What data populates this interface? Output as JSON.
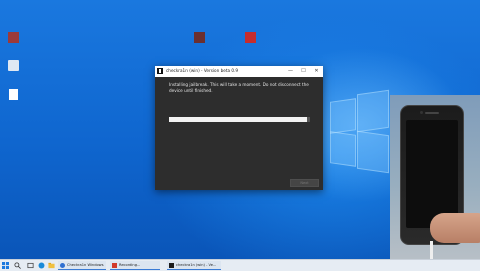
{
  "desktop": {
    "icons": [
      {
        "label": "",
        "glyph": "checkra1n-icon",
        "color": "#9b3a3a"
      },
      {
        "label": "",
        "glyph": "shortcut-icon",
        "color": "#6b2f2f"
      },
      {
        "label": "",
        "glyph": "recycle-bin-icon",
        "color": "#dfe8f3"
      },
      {
        "label": "",
        "glyph": "app-shortcut-icon",
        "color": "#c62d2d"
      },
      {
        "label": "",
        "glyph": "document-icon",
        "color": "#ffffff"
      }
    ]
  },
  "window": {
    "title": "checkra1n (win) - Version beta 0.9",
    "min_glyph": "—",
    "max_glyph": "☐",
    "close_glyph": "✕",
    "message": "Installing jailbreak. This will take a moment. Do not disconnect the device until finished.",
    "progress": 0.98,
    "next_label": "Next"
  },
  "taskbar": {
    "tasks": [
      {
        "label": "Checkra1n Windows...",
        "color": "#2f6fd0"
      },
      {
        "label": "Recording...",
        "color": "#d23a2a"
      },
      {
        "label": "checkra1n (win) - Ve...",
        "color": "#1c1c1c"
      }
    ],
    "tray_text": ""
  },
  "colors": {
    "accent": "#1a78df",
    "window_bg": "#2d2d2d",
    "progress_fill": "#f2f2f2"
  }
}
